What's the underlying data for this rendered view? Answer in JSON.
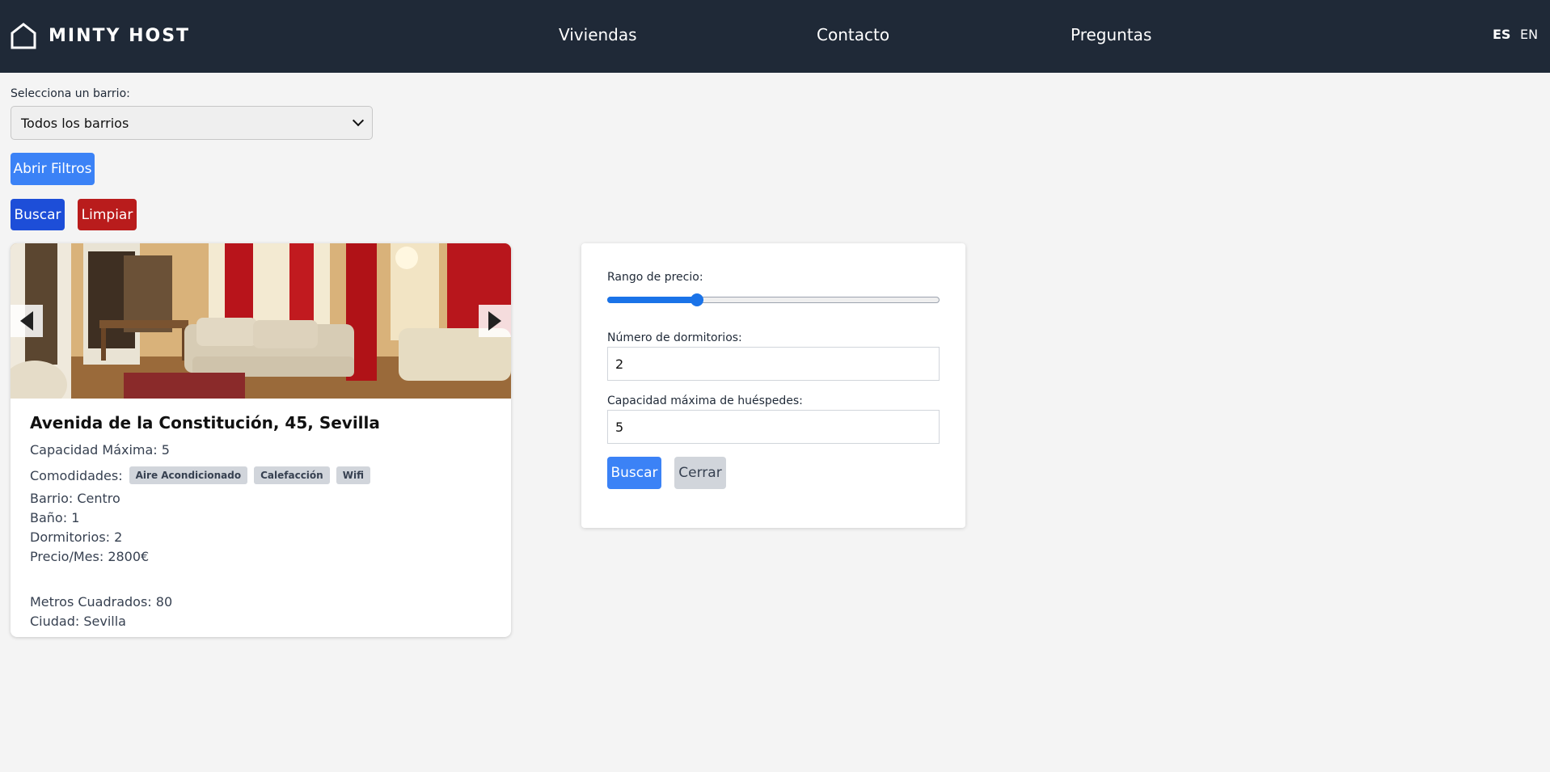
{
  "brand": {
    "name": "MINTY HOST"
  },
  "nav": {
    "items": [
      {
        "label": "Viviendas"
      },
      {
        "label": "Contacto"
      },
      {
        "label": "Preguntas"
      }
    ],
    "languages": [
      {
        "label": "ES",
        "active": true
      },
      {
        "label": "EN",
        "active": false
      }
    ]
  },
  "filters": {
    "barrio_label": "Selecciona un barrio:",
    "barrio_value": "Todos los barrios",
    "open_filters_label": "Abrir Filtros",
    "search_label": "Buscar",
    "clear_label": "Limpiar"
  },
  "listing": {
    "title": "Avenida de la Constitución, 45, Sevilla",
    "capacity": "Capacidad Máxima: 5",
    "amenities_label": "Comodidades:",
    "amenities": [
      "Aire Acondicionado",
      "Calefacción",
      "Wifi"
    ],
    "barrio": "Barrio: Centro",
    "bath": "Baño: 1",
    "bedrooms": "Dormitorios: 2",
    "price": "Precio/Mes: 2800€",
    "sqm": "Metros Cuadrados: 80",
    "city": "Ciudad: Sevilla"
  },
  "panel": {
    "price_range_label": "Rango de precio:",
    "price_range_fraction": 0.27,
    "bedrooms_label": "Número de dormitorios:",
    "bedrooms_value": "2",
    "guests_label": "Capacidad máxima de huéspedes:",
    "guests_value": "5",
    "search_label": "Buscar",
    "close_label": "Cerrar"
  },
  "colors": {
    "header_bg": "#1f2937",
    "primary": "#3b82f6",
    "primary_dark": "#1d4ed8",
    "danger": "#b91c1c",
    "tag_bg": "#d1d5db"
  }
}
